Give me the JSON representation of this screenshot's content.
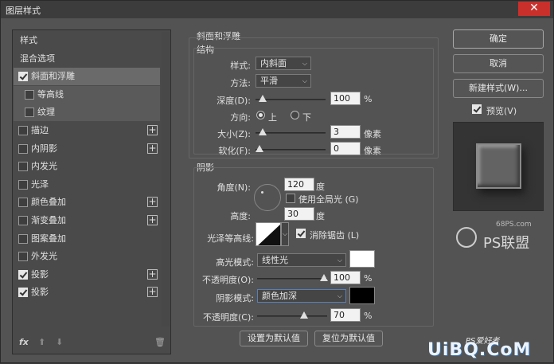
{
  "window": {
    "title": "图层样式",
    "close": "✕"
  },
  "left": {
    "items": [
      {
        "label": "样式",
        "checkbox": false,
        "checked": false,
        "plus": false
      },
      {
        "label": "混合选项",
        "checkbox": false,
        "checked": false,
        "plus": false
      },
      {
        "label": "斜面和浮雕",
        "checkbox": true,
        "checked": true,
        "plus": false,
        "selected": true
      },
      {
        "label": "等高线",
        "checkbox": true,
        "checked": false,
        "plus": false,
        "sub": true
      },
      {
        "label": "纹理",
        "checkbox": true,
        "checked": false,
        "plus": false,
        "sub": true
      },
      {
        "label": "描边",
        "checkbox": true,
        "checked": false,
        "plus": true
      },
      {
        "label": "内阴影",
        "checkbox": true,
        "checked": false,
        "plus": true
      },
      {
        "label": "内发光",
        "checkbox": true,
        "checked": false,
        "plus": false
      },
      {
        "label": "光泽",
        "checkbox": true,
        "checked": false,
        "plus": false
      },
      {
        "label": "颜色叠加",
        "checkbox": true,
        "checked": false,
        "plus": true
      },
      {
        "label": "渐变叠加",
        "checkbox": true,
        "checked": false,
        "plus": true
      },
      {
        "label": "图案叠加",
        "checkbox": true,
        "checked": false,
        "plus": false
      },
      {
        "label": "外发光",
        "checkbox": true,
        "checked": false,
        "plus": false
      },
      {
        "label": "投影",
        "checkbox": true,
        "checked": true,
        "plus": true
      },
      {
        "label": "投影",
        "checkbox": true,
        "checked": true,
        "plus": true
      }
    ],
    "tools": {
      "fx": "fx",
      "up": "⬆",
      "down": "⬇",
      "trash": "🗑"
    }
  },
  "bevel": {
    "section_title": "斜面和浮雕",
    "structure_title": "结构",
    "style_label": "样式:",
    "style_value": "内斜面",
    "technique_label": "方法:",
    "technique_value": "平滑",
    "depth_label": "深度(D):",
    "depth_value": "100",
    "depth_unit": "%",
    "direction_label": "方向:",
    "direction_up": "上",
    "direction_down": "下",
    "size_label": "大小(Z):",
    "size_value": "3",
    "size_unit": "像素",
    "soften_label": "软化(F):",
    "soften_value": "0",
    "soften_unit": "像素"
  },
  "shading": {
    "title": "阴影",
    "angle_label": "角度(N):",
    "angle_value": "120",
    "angle_unit": "度",
    "global_light_label": "使用全局光 (G)",
    "altitude_label": "高度:",
    "altitude_value": "30",
    "altitude_unit": "度",
    "gloss_label": "光泽等高线:",
    "antialias_label": "消除锯齿 (L)",
    "highlight_mode_label": "高光模式:",
    "highlight_mode_value": "线性光",
    "highlight_color": "#ffffff",
    "highlight_opacity_label": "不透明度(O):",
    "highlight_opacity_value": "100",
    "highlight_opacity_unit": "%",
    "shadow_mode_label": "阴影模式:",
    "shadow_mode_value": "颜色加深",
    "shadow_color": "#000000",
    "shadow_opacity_label": "不透明度(C):",
    "shadow_opacity_value": "70",
    "shadow_opacity_unit": "%"
  },
  "buttons": {
    "ok": "确定",
    "cancel": "取消",
    "new_style": "新建样式(W)...",
    "preview_label": "预览(V)",
    "set_default": "设置为默认值",
    "reset_default": "复位为默认值"
  },
  "watermark": {
    "site": "68PS.com",
    "brand": "PS联盟",
    "bottom": "UiBQ.CoM",
    "bottom_small": "PS爱好者"
  }
}
